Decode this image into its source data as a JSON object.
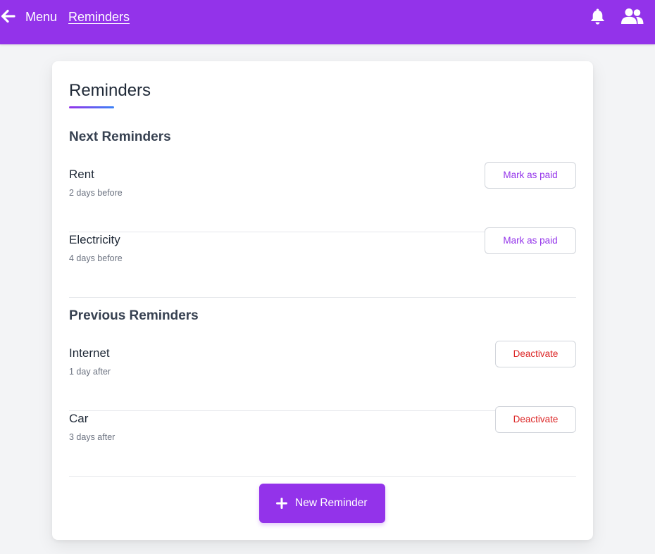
{
  "header": {
    "menu_label": "Menu",
    "breadcrumb": "Reminders",
    "icons": [
      "arrow-left-icon",
      "bell-icon",
      "users-icon"
    ],
    "background_color": "#9333ea"
  },
  "page": {
    "title": "Reminders",
    "next_heading": "Next Reminders",
    "previous_heading": "Previous Reminders",
    "next_reminders": [
      {
        "name": "Rent",
        "when": "2 days before",
        "action": "Mark as paid"
      },
      {
        "name": "Electricity",
        "when": "4 days before",
        "action": "Mark as paid"
      }
    ],
    "previous_reminders": [
      {
        "name": "Internet",
        "when": "1 day after",
        "action": "Deactivate"
      },
      {
        "name": "Car",
        "when": "3 days after",
        "action": "Deactivate"
      }
    ],
    "new_button_label": "New Reminder"
  },
  "colors": {
    "accent": "#9333ea",
    "danger": "#dc2626"
  }
}
